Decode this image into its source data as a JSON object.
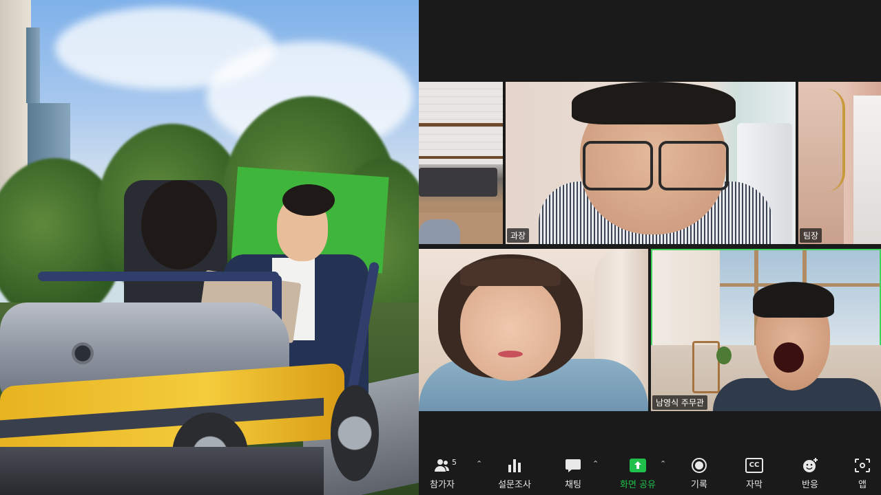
{
  "video": {
    "participants": [
      {
        "id": "p1",
        "name": "",
        "speaking": false
      },
      {
        "id": "p2",
        "name": "과장",
        "speaking": false
      },
      {
        "id": "p3",
        "name": "팀장",
        "speaking": false
      },
      {
        "id": "p4",
        "name": "",
        "speaking": false
      },
      {
        "id": "p5",
        "name": "남영식 주무관",
        "speaking": true
      }
    ]
  },
  "toolbar": {
    "participants_label": "참가자",
    "participants_count": "5",
    "polls_label": "설문조사",
    "chat_label": "채팅",
    "share_label": "화면 공유",
    "record_label": "기록",
    "captions_label": "자막",
    "reactions_label": "반응",
    "apps_label": "앱",
    "captions_icon_text": "CC",
    "share_color": "#1fc04b"
  }
}
